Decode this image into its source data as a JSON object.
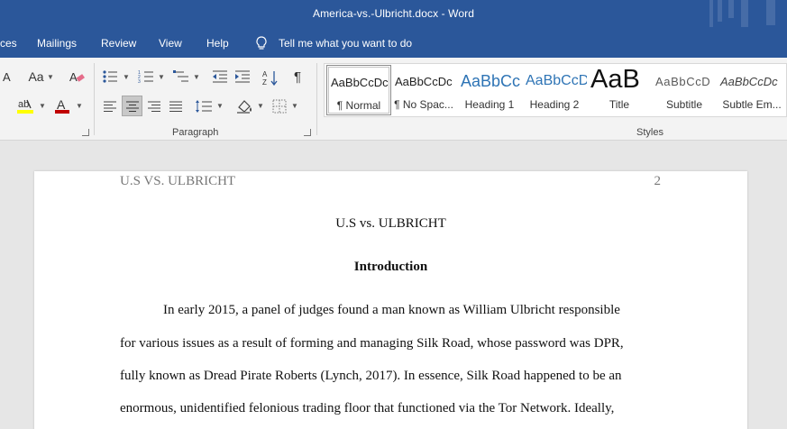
{
  "window": {
    "title": "America-vs.-Ulbricht.docx  -  Word"
  },
  "tabs": [
    "ces",
    "Mailings",
    "Review",
    "View",
    "Help"
  ],
  "tell_me": "Tell me what you want to do",
  "ribbon": {
    "font_size_glyph": "Aa",
    "paragraph_mark": "¶",
    "paragraph_group_label": "Paragraph",
    "styles_group_label": "Styles"
  },
  "styles": [
    {
      "sample": "AaBbCcDc",
      "name": "¶ Normal",
      "selected": true
    },
    {
      "sample": "AaBbCcDc",
      "name": "¶ No Spac..."
    },
    {
      "sample": "AaBbCc",
      "name": "Heading 1"
    },
    {
      "sample": "AaBbCcD",
      "name": "Heading 2"
    },
    {
      "sample": "AaB",
      "name": "Title"
    },
    {
      "sample": "AaBbCcD",
      "name": "Subtitle"
    },
    {
      "sample": "AaBbCcDc",
      "name": "Subtle Em..."
    }
  ],
  "colors": {
    "word_blue": "#2b579a",
    "font_color_red": "#c00000",
    "highlight_yellow": "#ffff00",
    "heading_blue": "#2e74b5"
  },
  "document": {
    "running_head": "U.S VS. ULBRICHT",
    "page_number": "2",
    "title": "U.S vs. ULBRICHT",
    "section_heading": "Introduction",
    "lines": [
      "In early 2015, a panel of judges found a man known as William Ulbricht responsible",
      "for various issues as a result of forming and managing Silk Road, whose password was DPR,",
      "fully known as Dread Pirate Roberts (Lynch, 2017). In essence, Silk Road happened to be an",
      "enormous, unidentified felonious trading floor that functioned via the Tor Network. Ideally,"
    ]
  }
}
